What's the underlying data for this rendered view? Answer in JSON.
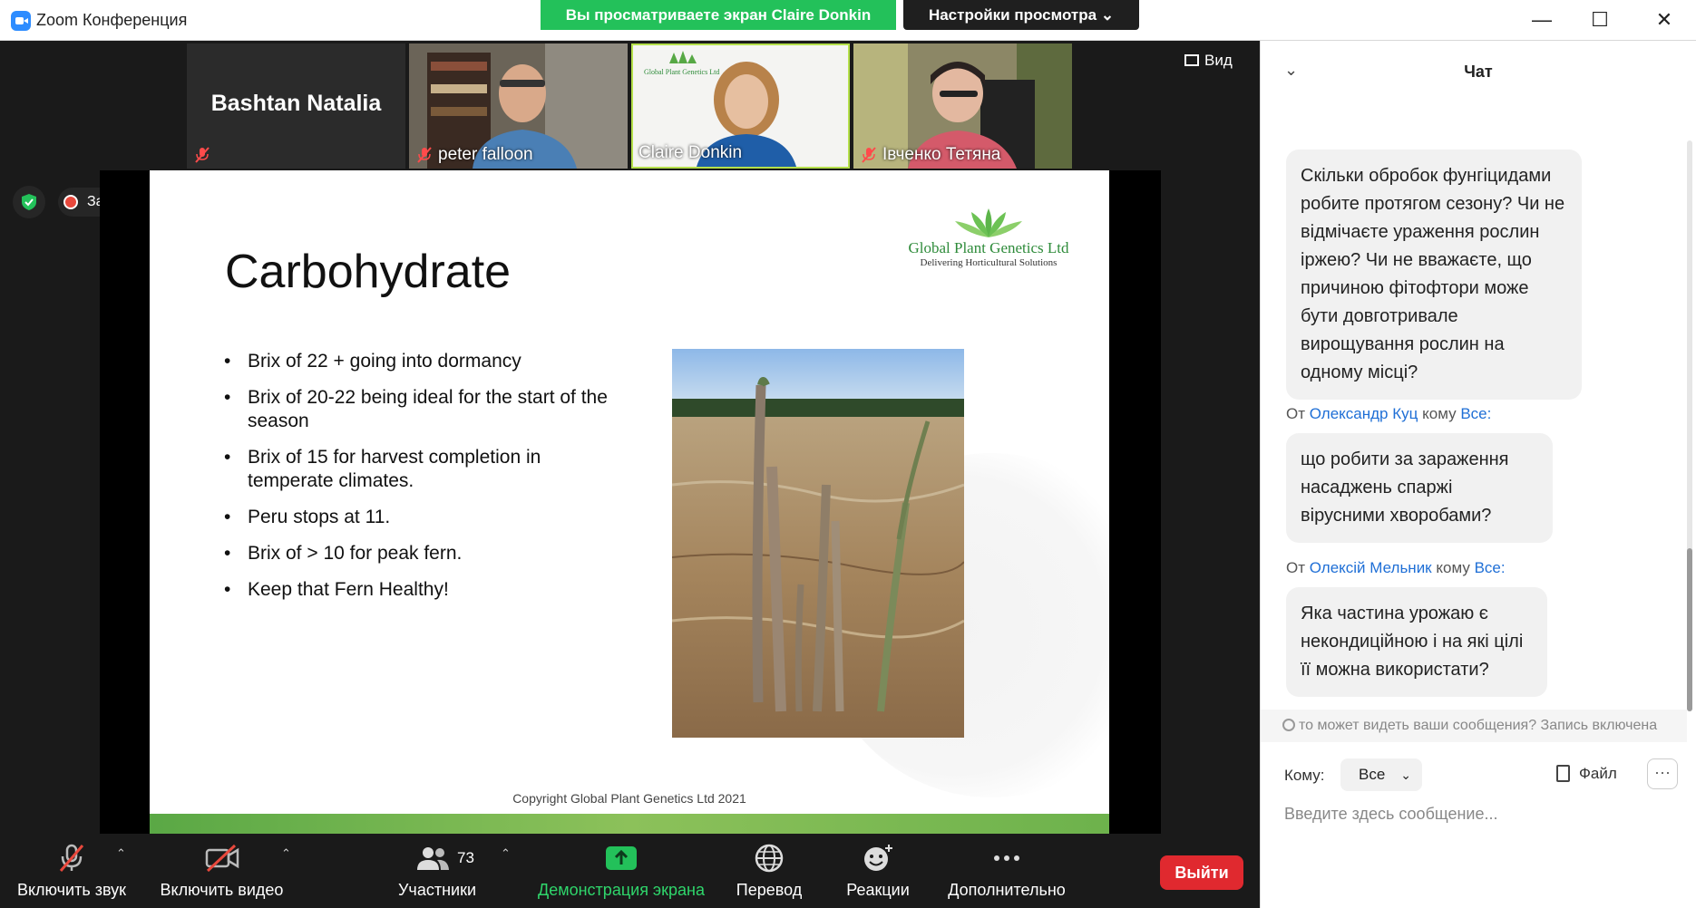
{
  "window": {
    "title": "Zoom Конференция",
    "share_banner": "Вы просматриваете экран Claire Donkin",
    "view_options": "Настройки просмотра ⌄",
    "controls": {
      "minimize": "—",
      "maximize": "☐",
      "close": "✕"
    }
  },
  "participants": [
    {
      "name": "Bashtan Natalia",
      "video": false,
      "muted": true
    },
    {
      "name": "peter falloon",
      "video": true,
      "muted": true
    },
    {
      "name": "Claire Donkin",
      "video": true,
      "muted": false,
      "active_speaker": true
    },
    {
      "name": "Івченко Тетяна",
      "video": true,
      "muted": true
    }
  ],
  "view_button": "Вид",
  "recording_label": "Запись",
  "slide": {
    "title": "Carbohydrate",
    "logo_name": "Global Plant Genetics Ltd",
    "logo_tagline": "Delivering Horticultural Solutions",
    "bullets": [
      "Brix of 22 + going into dormancy",
      "Brix of 20-22 being ideal for the start of the season",
      "Brix of 15 for harvest completion in temperate climates.",
      "Peru stops at 11.",
      "Brix of > 10 for peak fern.",
      "Keep that Fern Healthy!"
    ],
    "footer": "Copyright Global Plant Genetics Ltd 2021"
  },
  "toolbar": {
    "audio": "Включить звук",
    "video": "Включить видео",
    "participants": "Участники",
    "participants_count": "73",
    "share": "Демонстрация экрана",
    "translate": "Перевод",
    "reactions": "Реакции",
    "more": "Дополнительно",
    "leave": "Выйти"
  },
  "chat": {
    "title": "Чат",
    "messages": [
      {
        "text": "Скільки обробок фунгіцидами робите протягом сезону? Чи не відмічаєте  ураження рослин іржею? Чи не вважаєте, що причиною фітофтори може бути довготривале вирощування рослин на одному місці?"
      },
      {
        "from_prefix": "От",
        "from": "Олександр Куц",
        "to_prefix": "кому",
        "to": "Все:",
        "text": "що робити за зараження насаджень спаржі вірусними хворобами?"
      },
      {
        "from_prefix": "От",
        "from": "Олексій Мельник",
        "to_prefix": "кому",
        "to": "Все:",
        "text": "Яка частина урожаю є некондиційною і на які цілі її можна використати?"
      }
    ],
    "privacy_note": "то может видеть ваши сообщения? Запись включена",
    "to_label": "Кому:",
    "to_value": "Все",
    "file_label": "Файл",
    "more": "···",
    "input_placeholder": "Введите здесь сообщение..."
  },
  "colors": {
    "accent": "#2d8cff",
    "share_green": "#23c15a",
    "leave_red": "#e0292f",
    "link_blue": "#1f6fd6",
    "logo_green": "#2e8b3a"
  }
}
